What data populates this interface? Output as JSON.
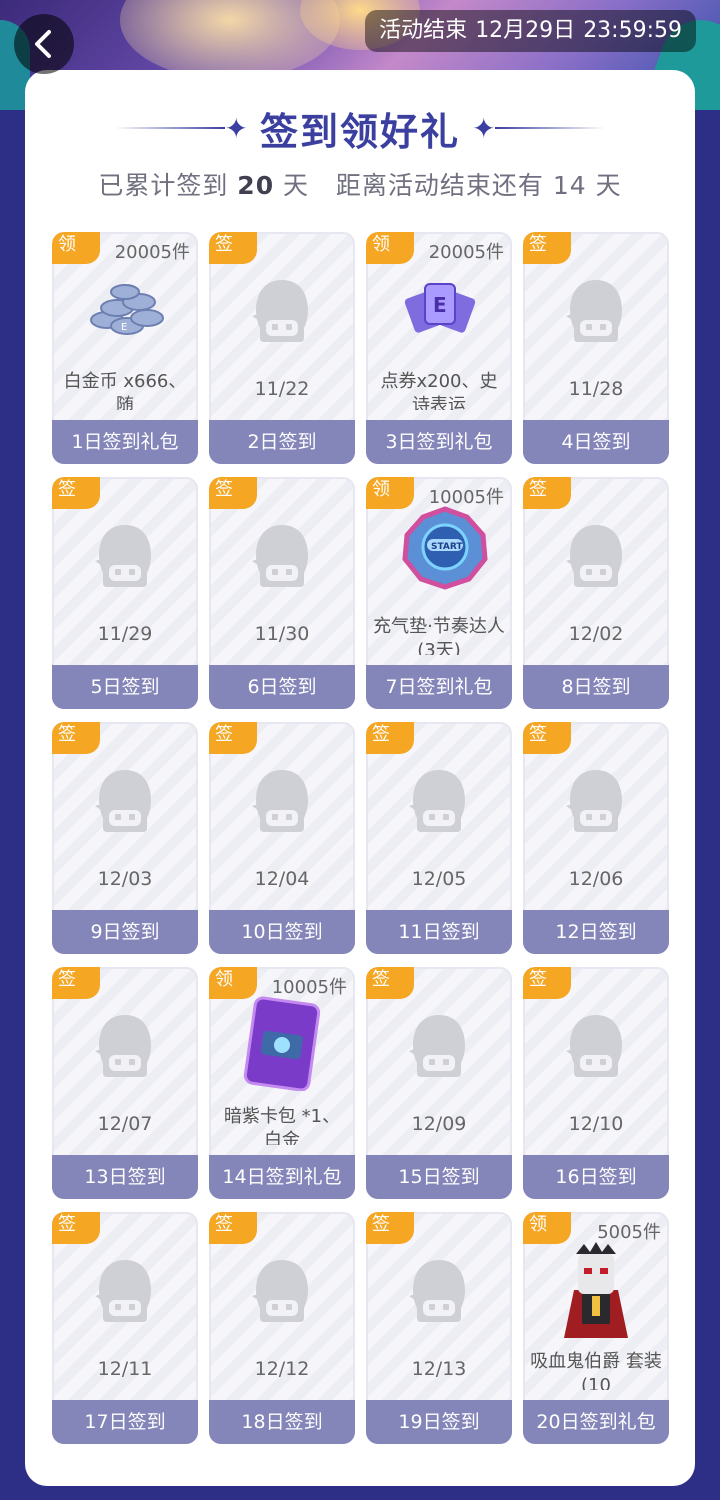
{
  "header": {
    "back_icon": "chevron-left-icon",
    "countdown_label": "活动结束",
    "countdown_date": "12月29日",
    "countdown_time": "23:59:59"
  },
  "panel": {
    "title": "签到领好礼",
    "subtitle_prefix": "已累计签到",
    "signed_days": "20",
    "days_unit": "天",
    "subtitle_middle": "距离活动结束还有",
    "remaining_days": "14",
    "remaining_unit": "天"
  },
  "colors": {
    "accent": "#3a3fa0",
    "tag_orange": "#f5a623",
    "footer_purple": "#8485b8",
    "page_bg": "#2d2f86"
  },
  "cards": [
    {
      "tag": "领",
      "count": "20005件",
      "item": "白金币 x666、随",
      "label": "1日签到礼包",
      "icon": "platinum-coins-icon"
    },
    {
      "tag": "签",
      "date": "11/22",
      "label": "2日签到"
    },
    {
      "tag": "领",
      "count": "20005件",
      "item": "点券x200、史诗表运",
      "label": "3日签到礼包",
      "icon": "voucher-cards-icon"
    },
    {
      "tag": "签",
      "date": "11/28",
      "label": "4日签到"
    },
    {
      "tag": "签",
      "date": "11/29",
      "label": "5日签到"
    },
    {
      "tag": "签",
      "date": "11/30",
      "label": "6日签到"
    },
    {
      "tag": "领",
      "count": "10005件",
      "item": "充气垫·节奏达人(3天)",
      "label": "7日签到礼包",
      "icon": "start-pad-icon"
    },
    {
      "tag": "签",
      "date": "12/02",
      "label": "8日签到"
    },
    {
      "tag": "签",
      "date": "12/03",
      "label": "9日签到"
    },
    {
      "tag": "签",
      "date": "12/04",
      "label": "10日签到"
    },
    {
      "tag": "签",
      "date": "12/05",
      "label": "11日签到"
    },
    {
      "tag": "签",
      "date": "12/06",
      "label": "12日签到"
    },
    {
      "tag": "签",
      "date": "12/07",
      "label": "13日签到"
    },
    {
      "tag": "领",
      "count": "10005件",
      "item": "暗紫卡包 *1、白金",
      "label": "14日签到礼包",
      "icon": "card-pack-icon"
    },
    {
      "tag": "签",
      "date": "12/09",
      "label": "15日签到"
    },
    {
      "tag": "签",
      "date": "12/10",
      "label": "16日签到"
    },
    {
      "tag": "签",
      "date": "12/11",
      "label": "17日签到"
    },
    {
      "tag": "签",
      "date": "12/12",
      "label": "18日签到"
    },
    {
      "tag": "签",
      "date": "12/13",
      "label": "19日签到"
    },
    {
      "tag": "领",
      "count": "5005件",
      "item": "吸血鬼伯爵 套装(10",
      "label": "20日签到礼包",
      "icon": "vampire-costume-icon"
    }
  ]
}
